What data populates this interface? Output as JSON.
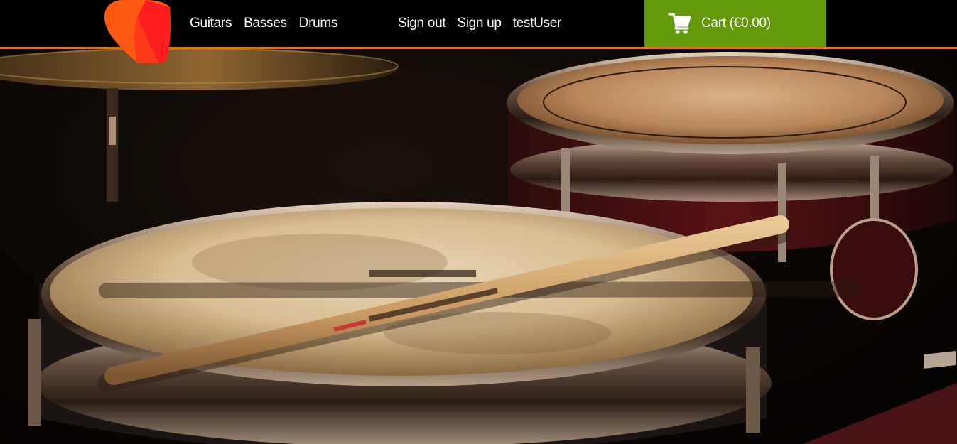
{
  "header": {
    "nav_left": [
      {
        "label": "Guitars"
      },
      {
        "label": "Basses"
      },
      {
        "label": "Drums"
      }
    ],
    "nav_right": [
      {
        "label": "Sign out"
      },
      {
        "label": "Sign up"
      },
      {
        "label": "testUser"
      }
    ],
    "cart": {
      "label": "Cart (€0.00)",
      "icon": "shopping-cart-icon"
    },
    "logo_icon": "guitar-pick-logo-icon"
  },
  "hero": {
    "image": "drum-kit-with-drumsticks-photo"
  },
  "colors": {
    "header_bg": "#000000",
    "header_border": "#d7781e",
    "cart_bg": "#64990a",
    "logo_orange": "#ff5a14",
    "logo_red": "#ff1e1e"
  }
}
